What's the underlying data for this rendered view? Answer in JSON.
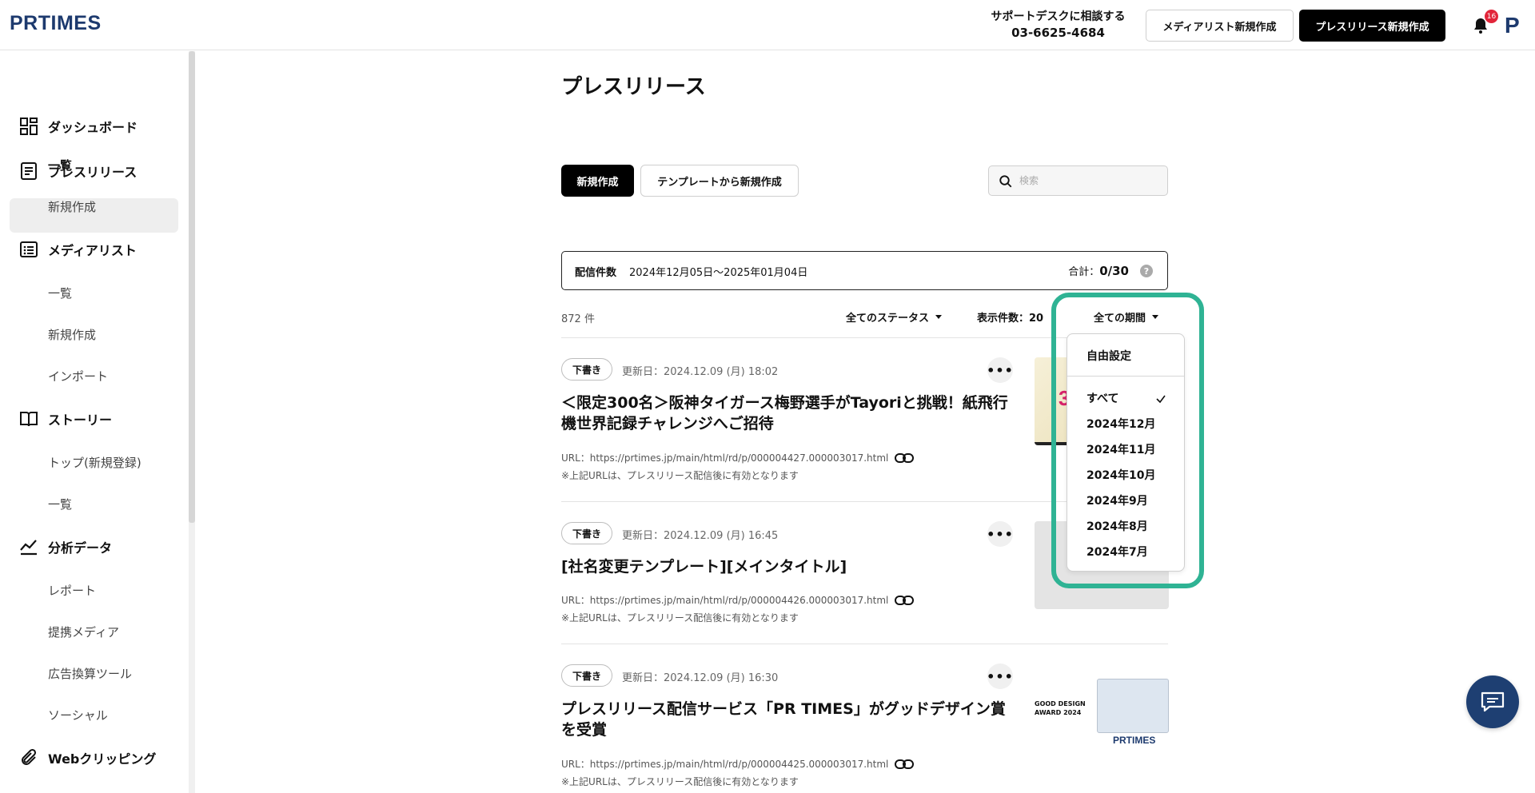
{
  "header": {
    "logo": "PRTIMES",
    "support_title": "サポートデスクに相談する",
    "support_phone": "03-6625-4684",
    "media_list_button": "メディアリスト新規作成",
    "press_release_button": "プレスリリース新規作成",
    "notification_count": "16",
    "avatar_letter": "P"
  },
  "sidebar": {
    "dashboard": "ダッシュボード",
    "press_release": "プレスリリース",
    "pr_list": "一覧",
    "pr_new": "新規作成",
    "media_list": "メディアリスト",
    "ml_list": "一覧",
    "ml_new": "新規作成",
    "ml_import": "インポート",
    "story": "ストーリー",
    "story_top": "トップ(新規登録)",
    "story_list": "一覧",
    "analytics": "分析データ",
    "report": "レポート",
    "partner_media": "提携メディア",
    "ad_tool": "広告換算ツール",
    "social": "ソーシャル",
    "web_clipping": "Webクリッピング"
  },
  "main": {
    "title": "プレスリリース",
    "new_button": "新規作成",
    "template_button": "テンプレートから新規作成",
    "search_placeholder": "検索",
    "distribution": {
      "label": "配信件数",
      "range": "2024年12月05日〜2025年01月04日",
      "total_label": "合計：",
      "total_value": "0/30",
      "help": "?"
    },
    "count": "872 件",
    "status_filter": "全てのステータス",
    "per_page": "表示件数：20",
    "period_filter": "全ての期間",
    "items": [
      {
        "badge": "下書き",
        "date": "更新日：2024.12.09 (月) 18:02",
        "title": "＜限定300名＞阪神タイガース梅野選手がTayoriと挑戦！紙飛行機世界記録チャレンジへご招待",
        "url": "URL：https://prtimes.jp/main/html/rd/p/000004427.000003017.html",
        "note": "※上記URLは、プレスリリース配信後に有効となります",
        "more": "•••"
      },
      {
        "badge": "下書き",
        "date": "更新日：2024.12.09 (月) 16:45",
        "title": "[社名変更テンプレート][メインタイトル]",
        "url": "URL：https://prtimes.jp/main/html/rd/p/000004426.000003017.html",
        "note": "※上記URLは、プレスリリース配信後に有効となります",
        "more": "•••"
      },
      {
        "badge": "下書き",
        "date": "更新日：2024.12.09 (月) 16:30",
        "title": "プレスリリース配信サービス「PR TIMES」がグッドデザイン賞を受賞",
        "url": "URL：https://prtimes.jp/main/html/rd/p/000004425.000003017.html",
        "note": "※上記URLは、プレスリリース配信後に有効となります",
        "more": "•••"
      }
    ],
    "thumb3_award": "GOOD DESIGN AWARD 2024",
    "thumb3_logo": "PRTIMES"
  },
  "dropdown": {
    "custom": "自由設定",
    "options": [
      "すべて",
      "2024年12月",
      "2024年11月",
      "2024年10月",
      "2024年9月",
      "2024年8月",
      "2024年7月"
    ],
    "selected": "すべて"
  },
  "colors": {
    "brand": "#1d3a6e",
    "highlight": "#2fb394",
    "badge": "#e2253a"
  }
}
